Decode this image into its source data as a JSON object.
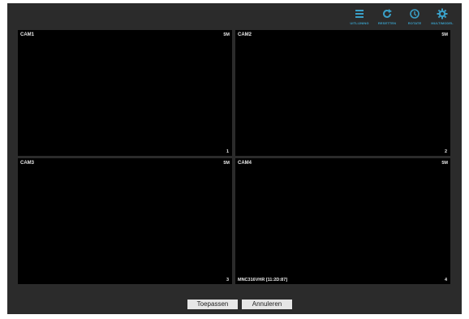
{
  "toolbar": {
    "items": [
      {
        "label": "UITLIJNING",
        "icon": "layout-list-icon"
      },
      {
        "label": "RESETTEN",
        "icon": "refresh-icon"
      },
      {
        "label": "ROTATE",
        "icon": "rotate-icon"
      },
      {
        "label": "MULTIMODEL",
        "icon": "gear-icon"
      }
    ],
    "accent_color": "#3aa0c8"
  },
  "cameras": [
    {
      "name": "CAM1",
      "resolution": "5M",
      "channel": "1",
      "info": ""
    },
    {
      "name": "CAM2",
      "resolution": "5M",
      "channel": "2",
      "info": ""
    },
    {
      "name": "CAM3",
      "resolution": "5M",
      "channel": "3",
      "info": ""
    },
    {
      "name": "CAM4",
      "resolution": "5M",
      "channel": "4",
      "info": "MNC316VHR [11:2D:87]"
    }
  ],
  "actions": {
    "apply_label": "Toepassen",
    "cancel_label": "Annuleren"
  }
}
